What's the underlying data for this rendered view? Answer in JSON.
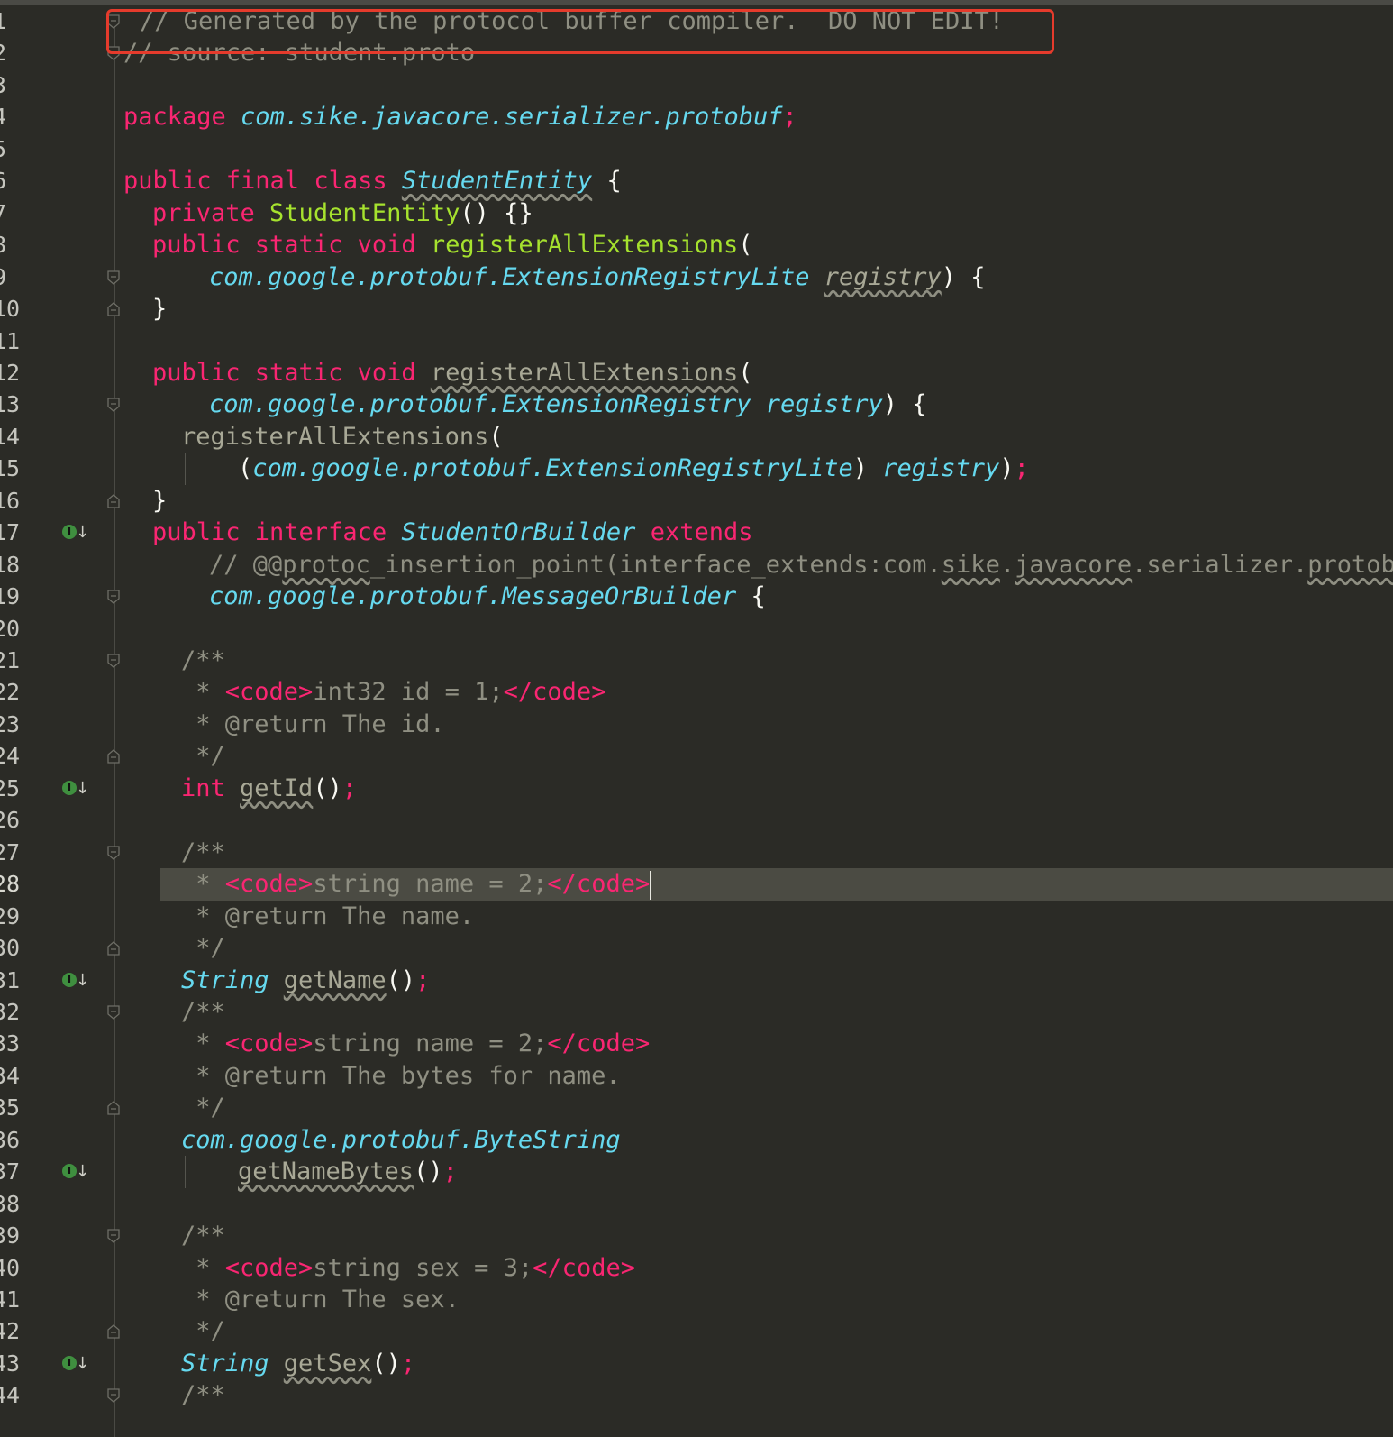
{
  "editor": {
    "current_line": 28,
    "lines": [
      {
        "n": "1",
        "tokens": [
          {
            "c": "cm",
            "t": "// Generated by the protocol buffer compiler.  DO NOT EDIT!"
          }
        ],
        "indent": 155,
        "fold": "open"
      },
      {
        "n": "2",
        "tokens": [
          {
            "c": "cm",
            "t": "// source: student.proto"
          }
        ],
        "indent": 137,
        "fold": "open"
      },
      {
        "n": "3",
        "tokens": [],
        "indent": 137
      },
      {
        "n": "4",
        "tokens": [
          {
            "c": "kw",
            "t": "package "
          },
          {
            "c": "pkg",
            "t": "com.sike.javacore.serializer.protobuf"
          },
          {
            "c": "kw",
            "t": ";"
          }
        ],
        "indent": 137
      },
      {
        "n": "5",
        "tokens": [],
        "indent": 137
      },
      {
        "n": "6",
        "tokens": [
          {
            "c": "kw",
            "t": "public final class "
          },
          {
            "c": "cls ul",
            "t": "StudentEntity"
          },
          {
            "c": "plain",
            "t": " {"
          }
        ],
        "indent": 137
      },
      {
        "n": "7",
        "tokens": [
          {
            "c": "kw",
            "t": "private "
          },
          {
            "c": "fn",
            "t": "StudentEntity"
          },
          {
            "c": "plain",
            "t": "() {}"
          }
        ],
        "indent": 169
      },
      {
        "n": "8",
        "tokens": [
          {
            "c": "kw",
            "t": "public static void "
          },
          {
            "c": "fn",
            "t": "registerAllExtensions"
          },
          {
            "c": "plain",
            "t": "("
          }
        ],
        "indent": 169
      },
      {
        "n": "9",
        "tokens": [
          {
            "c": "pkg",
            "t": "com.google.protobuf.ExtensionRegistryLite"
          },
          {
            "c": "plain",
            "t": " "
          },
          {
            "c": "param ul",
            "t": "registry"
          },
          {
            "c": "plain",
            "t": ") {"
          }
        ],
        "indent": 232,
        "fold": "open"
      },
      {
        "n": "10",
        "tokens": [
          {
            "c": "plain",
            "t": "}"
          }
        ],
        "indent": 169,
        "fold": "close"
      },
      {
        "n": "11",
        "tokens": [],
        "indent": 137
      },
      {
        "n": "12",
        "tokens": [
          {
            "c": "kw",
            "t": "public static void "
          },
          {
            "c": "dim ul",
            "t": "registerAllExtensions"
          },
          {
            "c": "plain",
            "t": "("
          }
        ],
        "indent": 169
      },
      {
        "n": "13",
        "tokens": [
          {
            "c": "pkg",
            "t": "com.google.protobuf.ExtensionRegistry"
          },
          {
            "c": "plain",
            "t": " "
          },
          {
            "c": "pkg",
            "t": "registry"
          },
          {
            "c": "plain",
            "t": ") {"
          }
        ],
        "indent": 232,
        "fold": "open"
      },
      {
        "n": "14",
        "tokens": [
          {
            "c": "dim",
            "t": "registerAllExtensions"
          },
          {
            "c": "plain",
            "t": "("
          }
        ],
        "indent": 201
      },
      {
        "n": "15",
        "tokens": [
          {
            "c": "plain",
            "t": "("
          },
          {
            "c": "pkg",
            "t": "com.google.protobuf.ExtensionRegistryLite"
          },
          {
            "c": "plain",
            "t": ") "
          },
          {
            "c": "pkg",
            "t": "registry"
          },
          {
            "c": "plain",
            "t": ")"
          },
          {
            "c": "kw",
            "t": ";"
          }
        ],
        "indent": 264,
        "pipe": 205
      },
      {
        "n": "16",
        "tokens": [
          {
            "c": "plain",
            "t": "}"
          }
        ],
        "indent": 169,
        "fold": "close"
      },
      {
        "n": "17",
        "tokens": [
          {
            "c": "kw",
            "t": "public interface "
          },
          {
            "c": "cls",
            "t": "StudentOrBuilder"
          },
          {
            "c": "kw",
            "t": " extends"
          }
        ],
        "indent": 169,
        "impl": true
      },
      {
        "n": "18",
        "tokens": [
          {
            "c": "cm",
            "t": "// @@"
          },
          {
            "c": "cm ul",
            "t": "protoc"
          },
          {
            "c": "cm",
            "t": "_insertion_point(interface_extends:com."
          },
          {
            "c": "cm ul",
            "t": "sike"
          },
          {
            "c": "cm",
            "t": "."
          },
          {
            "c": "cm ul",
            "t": "javacore"
          },
          {
            "c": "cm",
            "t": ".serializer."
          },
          {
            "c": "cm ul",
            "t": "protobuf"
          }
        ],
        "indent": 232
      },
      {
        "n": "19",
        "tokens": [
          {
            "c": "pkg",
            "t": "com.google.protobuf.MessageOrBuilder"
          },
          {
            "c": "plain",
            "t": " {"
          }
        ],
        "indent": 232,
        "fold": "open"
      },
      {
        "n": "20",
        "tokens": [],
        "indent": 137
      },
      {
        "n": "21",
        "tokens": [
          {
            "c": "cm",
            "t": "/**"
          }
        ],
        "indent": 201,
        "fold": "open"
      },
      {
        "n": "22",
        "tokens": [
          {
            "c": "cm",
            "t": " * "
          },
          {
            "c": "cmtag",
            "t": "<code>"
          },
          {
            "c": "cm",
            "t": "int32 id = 1;"
          },
          {
            "c": "cmtag",
            "t": "</code>"
          }
        ],
        "indent": 201
      },
      {
        "n": "23",
        "tokens": [
          {
            "c": "cm",
            "t": " * @return The id."
          }
        ],
        "indent": 201
      },
      {
        "n": "24",
        "tokens": [
          {
            "c": "cm",
            "t": " */"
          }
        ],
        "indent": 201,
        "fold": "close"
      },
      {
        "n": "25",
        "tokens": [
          {
            "c": "kw",
            "t": "int "
          },
          {
            "c": "dim ul",
            "t": "getId"
          },
          {
            "c": "plain",
            "t": "()"
          },
          {
            "c": "kw",
            "t": ";"
          }
        ],
        "indent": 201,
        "impl": true
      },
      {
        "n": "26",
        "tokens": [],
        "indent": 137
      },
      {
        "n": "27",
        "tokens": [
          {
            "c": "cm",
            "t": "/**"
          }
        ],
        "indent": 201,
        "fold": "open"
      },
      {
        "n": "28",
        "tokens": [
          {
            "c": "cm",
            "t": " * "
          },
          {
            "c": "cmtag",
            "t": "<code>"
          },
          {
            "c": "cm",
            "t": "string name = 2;"
          },
          {
            "c": "cmtag",
            "t": "</code>"
          }
        ],
        "indent": 201,
        "caret": true
      },
      {
        "n": "29",
        "tokens": [
          {
            "c": "cm",
            "t": " * @return The name."
          }
        ],
        "indent": 201
      },
      {
        "n": "30",
        "tokens": [
          {
            "c": "cm",
            "t": " */"
          }
        ],
        "indent": 201,
        "fold": "close"
      },
      {
        "n": "31",
        "tokens": [
          {
            "c": "cls",
            "t": "String "
          },
          {
            "c": "dim ul",
            "t": "getName"
          },
          {
            "c": "plain",
            "t": "()"
          },
          {
            "c": "kw",
            "t": ";"
          }
        ],
        "indent": 201,
        "impl": true
      },
      {
        "n": "32",
        "tokens": [
          {
            "c": "cm",
            "t": "/**"
          }
        ],
        "indent": 201,
        "fold": "open"
      },
      {
        "n": "33",
        "tokens": [
          {
            "c": "cm",
            "t": " * "
          },
          {
            "c": "cmtag",
            "t": "<code>"
          },
          {
            "c": "cm",
            "t": "string name = 2;"
          },
          {
            "c": "cmtag",
            "t": "</code>"
          }
        ],
        "indent": 201
      },
      {
        "n": "34",
        "tokens": [
          {
            "c": "cm",
            "t": " * @return The bytes for name."
          }
        ],
        "indent": 201
      },
      {
        "n": "35",
        "tokens": [
          {
            "c": "cm",
            "t": " */"
          }
        ],
        "indent": 201,
        "fold": "close"
      },
      {
        "n": "36",
        "tokens": [
          {
            "c": "pkg",
            "t": "com.google.protobuf.ByteString"
          }
        ],
        "indent": 201
      },
      {
        "n": "37",
        "tokens": [
          {
            "c": "dim ul",
            "t": "getNameBytes"
          },
          {
            "c": "plain",
            "t": "()"
          },
          {
            "c": "kw",
            "t": ";"
          }
        ],
        "indent": 264,
        "impl": true,
        "pipe": 205
      },
      {
        "n": "38",
        "tokens": [],
        "indent": 137
      },
      {
        "n": "39",
        "tokens": [
          {
            "c": "cm",
            "t": "/**"
          }
        ],
        "indent": 201,
        "fold": "open"
      },
      {
        "n": "40",
        "tokens": [
          {
            "c": "cm",
            "t": " * "
          },
          {
            "c": "cmtag",
            "t": "<code>"
          },
          {
            "c": "cm",
            "t": "string sex = 3;"
          },
          {
            "c": "cmtag",
            "t": "</code>"
          }
        ],
        "indent": 201
      },
      {
        "n": "41",
        "tokens": [
          {
            "c": "cm",
            "t": " * @return The sex."
          }
        ],
        "indent": 201
      },
      {
        "n": "42",
        "tokens": [
          {
            "c": "cm",
            "t": " */"
          }
        ],
        "indent": 201,
        "fold": "close"
      },
      {
        "n": "43",
        "tokens": [
          {
            "c": "cls",
            "t": "String "
          },
          {
            "c": "dim ul",
            "t": "getSex"
          },
          {
            "c": "plain",
            "t": "()"
          },
          {
            "c": "kw",
            "t": ";"
          }
        ],
        "indent": 201,
        "impl": true
      },
      {
        "n": "44",
        "tokens": [
          {
            "c": "cm",
            "t": "/**"
          }
        ],
        "indent": 201,
        "fold": "open"
      }
    ]
  },
  "impl_icon_letter": "I",
  "impl_arrow_glyph": "↓",
  "colors": {
    "background": "#2b2b26",
    "keyword": "#f92672",
    "type": "#66d9ef",
    "function": "#a6e22e",
    "comment": "#8f8f82",
    "annotation_box": "#e53b2c"
  }
}
